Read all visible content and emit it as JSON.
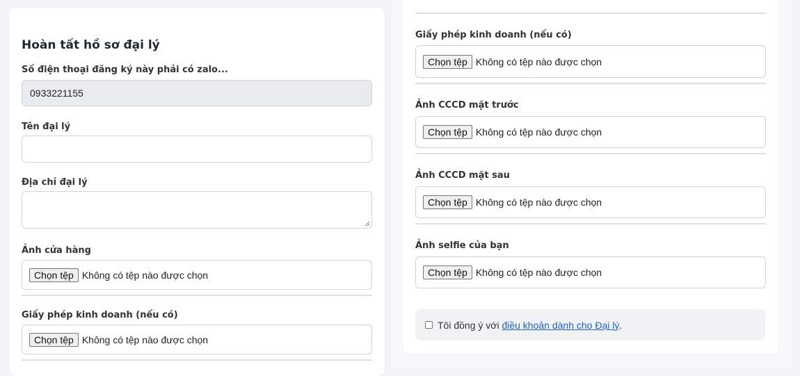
{
  "left_form": {
    "title": "Hoàn tất hồ sơ đại lý",
    "phone": {
      "label": "Số điện thoại đăng ký này phải có zalo...",
      "value": "0933221155"
    },
    "agent_name": {
      "label": "Tên đại lý",
      "value": ""
    },
    "agent_address": {
      "label": "Địa chỉ đại lý",
      "value": ""
    },
    "store_photo": {
      "label": "Ảnh cửa hàng",
      "button": "Chọn tệp",
      "status": "Không có tệp nào được chọn"
    },
    "business_license": {
      "label": "Giấy phép kinh doanh (nếu có)",
      "button": "Chọn tệp",
      "status": "Không có tệp nào được chọn"
    }
  },
  "right_form": {
    "business_license": {
      "label": "Giấy phép kinh doanh (nếu có)",
      "button": "Chọn tệp",
      "status": "Không có tệp nào được chọn"
    },
    "id_front": {
      "label": "Ảnh CCCD mặt trước",
      "button": "Chọn tệp",
      "status": "Không có tệp nào được chọn"
    },
    "id_back": {
      "label": "Ảnh CCCD mặt sau",
      "button": "Chọn tệp",
      "status": "Không có tệp nào được chọn"
    },
    "selfie": {
      "label": "Ảnh selfie của bạn",
      "button": "Chọn tệp",
      "status": "Không có tệp nào được chọn"
    },
    "terms": {
      "prefix": "Tôi đồng ý với ",
      "link": "điều khoản dành cho Đại lý",
      "suffix": ".",
      "checked": false
    }
  },
  "colors": {
    "link": "#1a63c7",
    "readonly_bg": "#e9ecef",
    "terms_bg": "#f1f2f4"
  }
}
